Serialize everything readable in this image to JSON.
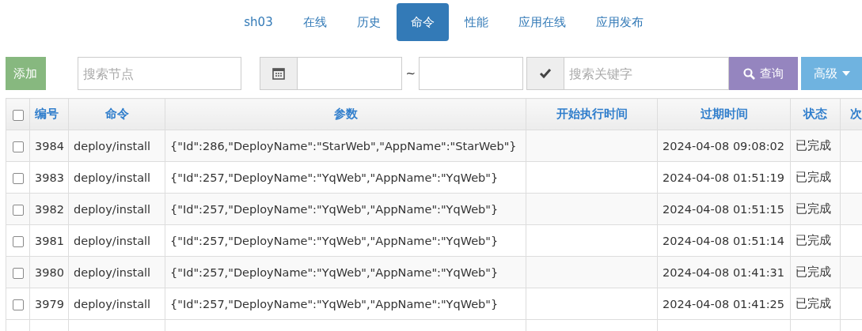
{
  "tabs": [
    {
      "label": "sh03",
      "selected": false
    },
    {
      "label": "在线",
      "selected": false
    },
    {
      "label": "历史",
      "selected": false
    },
    {
      "label": "命令",
      "selected": true
    },
    {
      "label": "性能",
      "selected": false
    },
    {
      "label": "应用在线",
      "selected": false
    },
    {
      "label": "应用发布",
      "selected": false
    }
  ],
  "toolbar": {
    "add_button": "添加",
    "node_search": {
      "placeholder": "搜索节点"
    },
    "date_separator": "~",
    "keyword_search": {
      "placeholder": "搜索关键字"
    },
    "query_button": "查询",
    "advanced_button": "高级"
  },
  "table": {
    "header_checkbox": {
      "checked": false
    },
    "columns": [
      "编号",
      "命令",
      "参数",
      "开始执行时间",
      "过期时间",
      "状态",
      "次"
    ],
    "rows": [
      {
        "checked": false,
        "cells": [
          "3984",
          "deploy/install",
          "{\"Id\":286,\"DeployName\":\"StarWeb\",\"AppName\":\"StarWeb\"}",
          "",
          "2024-04-08 09:08:02",
          "已完成"
        ]
      },
      {
        "checked": false,
        "cells": [
          "3983",
          "deploy/install",
          "{\"Id\":257,\"DeployName\":\"YqWeb\",\"AppName\":\"YqWeb\"}",
          "",
          "2024-04-08 01:51:19",
          "已完成"
        ]
      },
      {
        "checked": false,
        "cells": [
          "3982",
          "deploy/install",
          "{\"Id\":257,\"DeployName\":\"YqWeb\",\"AppName\":\"YqWeb\"}",
          "",
          "2024-04-08 01:51:15",
          "已完成"
        ]
      },
      {
        "checked": false,
        "cells": [
          "3981",
          "deploy/install",
          "{\"Id\":257,\"DeployName\":\"YqWeb\",\"AppName\":\"YqWeb\"}",
          "",
          "2024-04-08 01:51:14",
          "已完成"
        ]
      },
      {
        "checked": false,
        "cells": [
          "3980",
          "deploy/install",
          "{\"Id\":257,\"DeployName\":\"YqWeb\",\"AppName\":\"YqWeb\"}",
          "",
          "2024-04-08 01:41:31",
          "已完成"
        ]
      },
      {
        "checked": false,
        "cells": [
          "3979",
          "deploy/install",
          "{\"Id\":257,\"DeployName\":\"YqWeb\",\"AppName\":\"YqWeb\"}",
          "",
          "2024-04-08 01:41:25",
          "已完成"
        ]
      }
    ]
  }
}
